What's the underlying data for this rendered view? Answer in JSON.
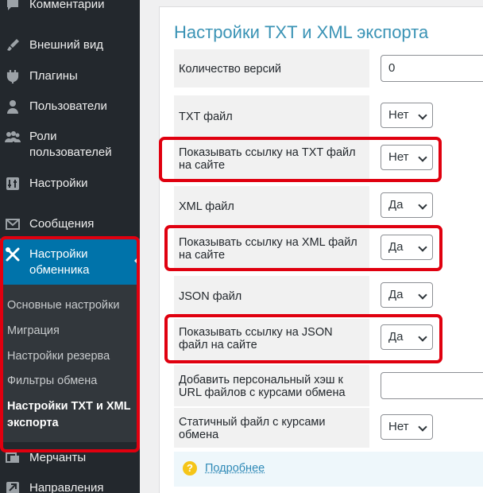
{
  "sidebar": {
    "items": [
      {
        "icon": "comments-icon",
        "label": "Комментарии"
      },
      {
        "icon": "appearance-icon",
        "label": "Внешний вид"
      },
      {
        "icon": "plugins-icon",
        "label": "Плагины"
      },
      {
        "icon": "users-icon",
        "label": "Пользователи"
      },
      {
        "icon": "user-roles-icon",
        "label": "Роли\nпользователей"
      },
      {
        "icon": "settings-icon",
        "label": "Настройки"
      },
      {
        "icon": "messages-icon",
        "label": "Сообщения"
      },
      {
        "icon": "tools-icon",
        "label": "Настройки\nобменника"
      },
      {
        "icon": "merchants-icon",
        "label": "Мерчанты"
      },
      {
        "icon": "directions-icon",
        "label": "Направления"
      }
    ],
    "submenu": [
      "Основные настройки",
      "Миграция",
      "Настройки резерва",
      "Фильтры обмена",
      "Настройки TXT и XML\nэкспорта"
    ],
    "accent_color": "#0073aa",
    "highlight_color": "#e0000f"
  },
  "main": {
    "title": "Настройки TXT и XML экспорта",
    "rows": [
      {
        "label": "Количество версий",
        "control": "input",
        "value": "0"
      },
      {
        "label": "TXT файл",
        "control": "select",
        "value": "Нет"
      },
      {
        "label": "Показывать ссылку на TXT файл\nна сайте",
        "control": "select",
        "value": "Нет"
      },
      {
        "label": "XML файл",
        "control": "select",
        "value": "Да"
      },
      {
        "label": "Показывать ссылку на XML файл\nна сайте",
        "control": "select",
        "value": "Да"
      },
      {
        "label": "JSON файл",
        "control": "select",
        "value": "Да"
      },
      {
        "label": "Показывать ссылку на JSON\nфайл на сайте",
        "control": "select",
        "value": "Да"
      },
      {
        "label": "Добавить персональный хэш к\nURL файлов с курсами обмена",
        "control": "input",
        "value": ""
      },
      {
        "label": "Статичный файл с курсами\nобмена",
        "control": "select",
        "value": "Нет"
      }
    ],
    "help": {
      "icon": "question-icon",
      "link": "Подробнее"
    }
  }
}
